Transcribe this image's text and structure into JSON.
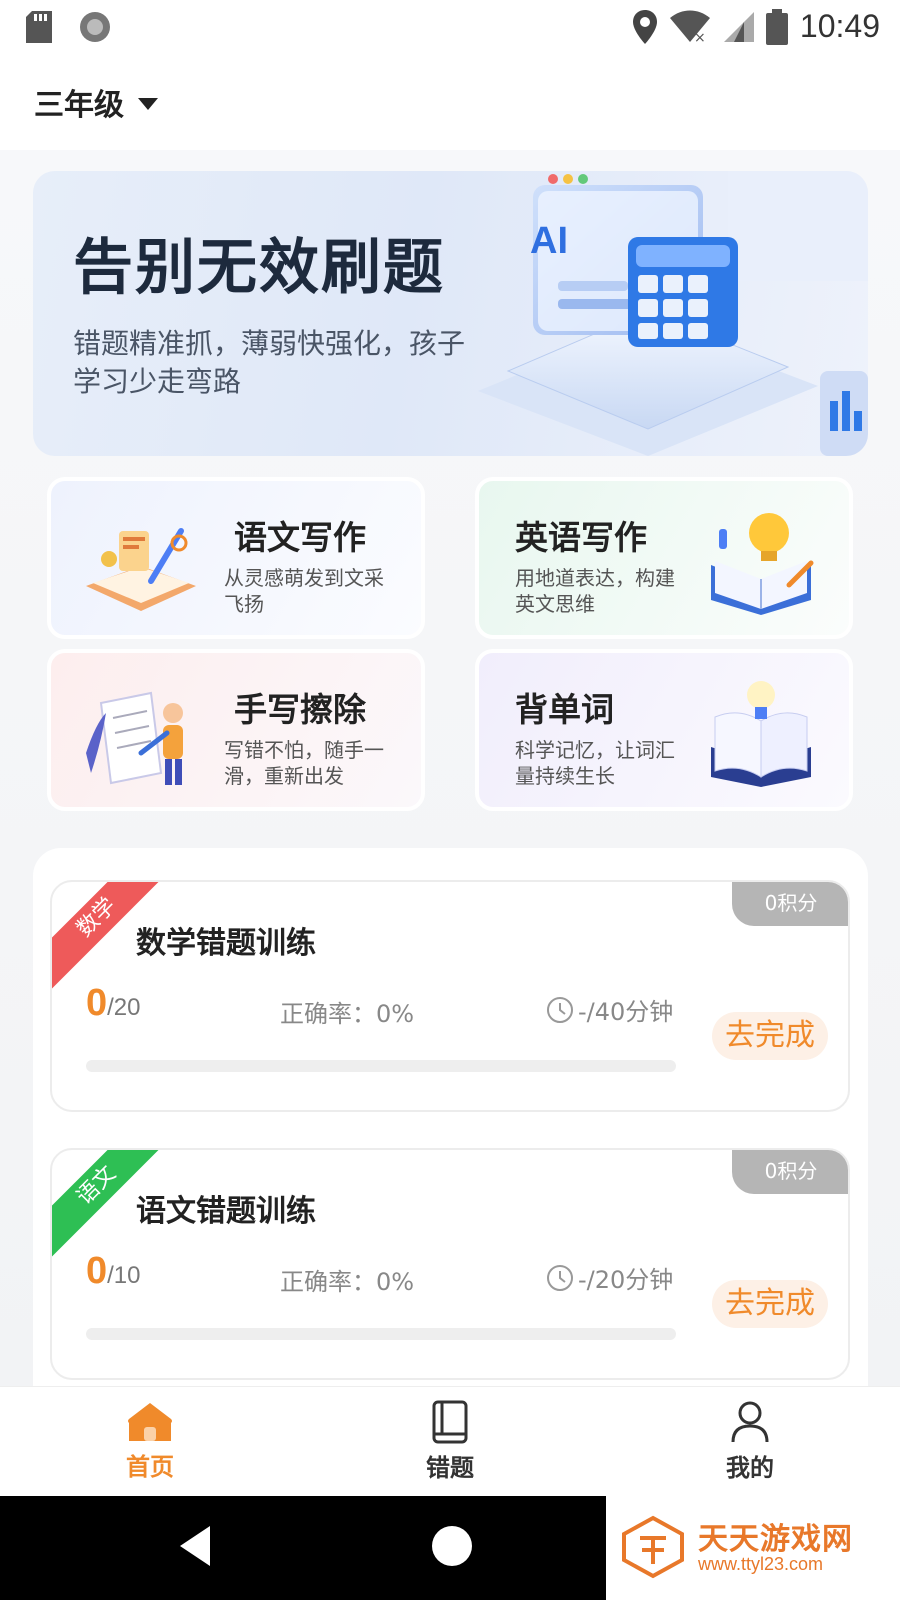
{
  "status_bar": {
    "time": "10:49"
  },
  "header": {
    "grade": "三年级"
  },
  "banner": {
    "title": "告别无效刷题",
    "subtitle": "错题精准抓，薄弱快强化，孩子学习少走弯路",
    "art_text": "AI"
  },
  "features": [
    {
      "title": "语文写作",
      "desc": "从灵感萌发到文采飞扬"
    },
    {
      "title": "英语写作",
      "desc": "用地道表达，构建英文思维"
    },
    {
      "title": "手写擦除",
      "desc": "写错不怕，随手一滑，重新出发"
    },
    {
      "title": "背单词",
      "desc": "科学记忆，让词汇量持续生长"
    }
  ],
  "tasks": [
    {
      "tag": "数学",
      "tag_color": "#ee5a5a",
      "title": "数学错题训练",
      "points": "0积分",
      "done": "0",
      "total": "/20",
      "accuracy": "正确率：0%",
      "duration": "-/40分钟",
      "action": "去完成",
      "progress_fraction": 0
    },
    {
      "tag": "语文",
      "tag_color": "#2ebf54",
      "title": "语文错题训练",
      "points": "0积分",
      "done": "0",
      "total": "/10",
      "accuracy": "正确率：0%",
      "duration": "-/20分钟",
      "action": "去完成",
      "progress_fraction": 0
    }
  ],
  "nav": [
    {
      "label": "首页",
      "icon": "home-icon",
      "active": true
    },
    {
      "label": "错题",
      "icon": "book-icon",
      "active": false
    },
    {
      "label": "我的",
      "icon": "user-icon",
      "active": false
    }
  ],
  "watermark": {
    "title": "天天游戏网",
    "url": "www.ttyl23.com"
  },
  "colors": {
    "accent": "#f08a2b",
    "math_tag": "#ee5a5a",
    "chinese_tag": "#2ebf54"
  }
}
